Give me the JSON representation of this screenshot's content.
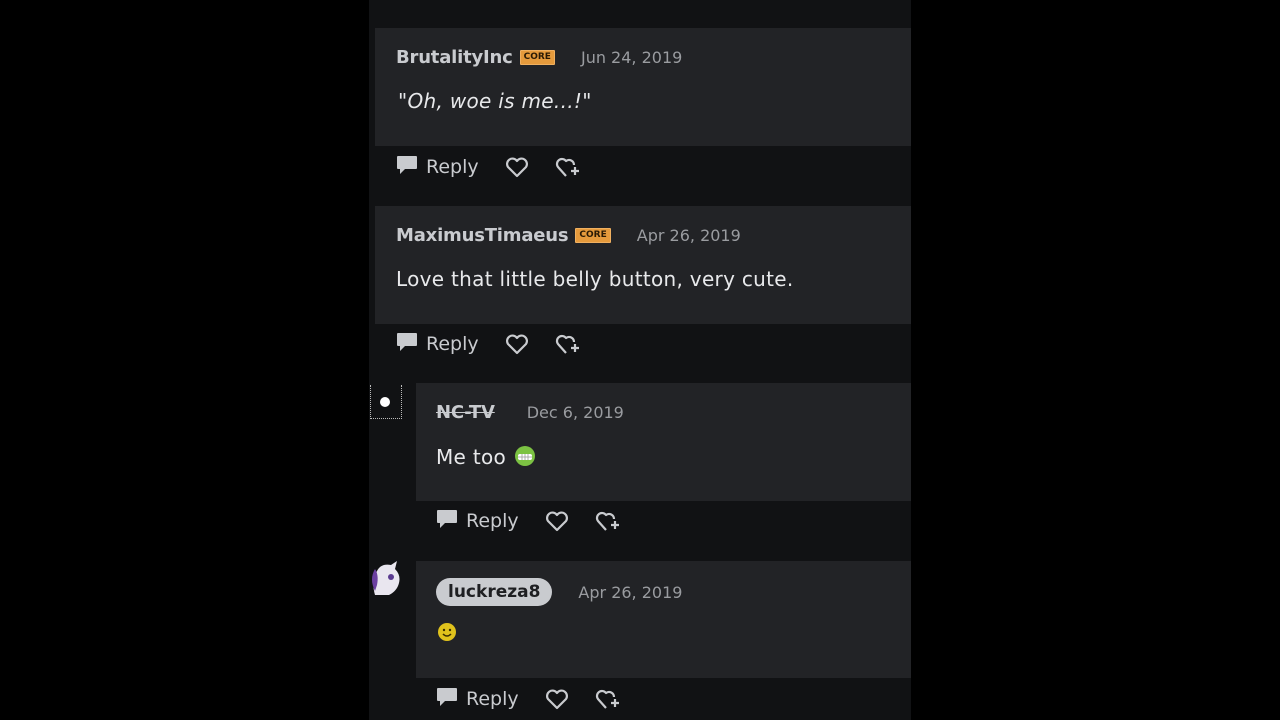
{
  "comments": [
    {
      "username": "BrutalityInc",
      "badge": "CORE",
      "date": "Jun 24, 2019",
      "text": "\"Oh, woe is me...!\""
    },
    {
      "username": "MaximusTimaeus",
      "badge": "CORE",
      "date": "Apr 26, 2019",
      "text": "Love that little belly button, very cute."
    },
    {
      "username": "NC-TV",
      "date": "Dec 6, 2019",
      "text": "Me too"
    },
    {
      "username": "luckreza8",
      "date": "Apr 26, 2019",
      "text": ""
    }
  ],
  "actions": {
    "reply_label": "Reply"
  },
  "icons": {
    "reply": "speech-bubble-icon",
    "like": "heart-outline-icon",
    "add_reaction": "heart-plus-icon"
  },
  "colors": {
    "badge": "#e59a3c",
    "panel": "#222326",
    "background": "#111214"
  }
}
